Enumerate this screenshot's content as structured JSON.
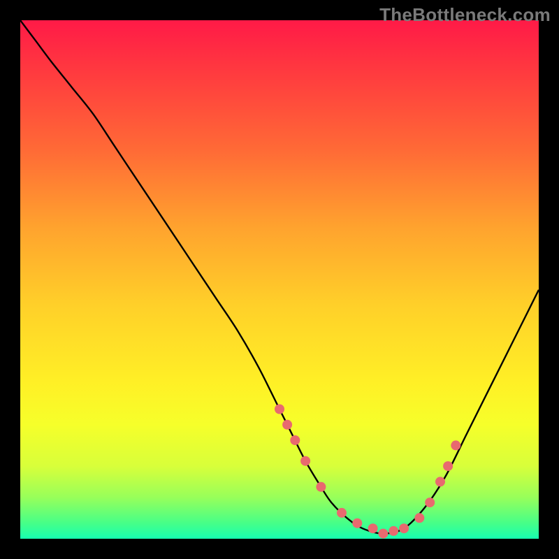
{
  "watermark": "TheBottleneck.com",
  "colors": {
    "gradient_top": "#ff1a47",
    "gradient_bottom": "#17ffb0",
    "curve": "#000000",
    "markers": "#e86a6f",
    "frame": "#000000"
  },
  "chart_data": {
    "type": "line",
    "title": "",
    "xlabel": "",
    "ylabel": "",
    "xlim": [
      0,
      100
    ],
    "ylim": [
      0,
      100
    ],
    "grid": false,
    "series": [
      {
        "name": "bottleneck-curve",
        "x": [
          0,
          3,
          6,
          10,
          14,
          18,
          22,
          26,
          30,
          34,
          38,
          42,
          46,
          50,
          52,
          55,
          58,
          60,
          63,
          66,
          70,
          74,
          78,
          82,
          86,
          90,
          94,
          98,
          100
        ],
        "y": [
          100,
          96,
          92,
          87,
          82,
          76,
          70,
          64,
          58,
          52,
          46,
          40,
          33,
          25,
          21,
          15,
          10,
          7,
          4,
          2,
          1,
          2,
          6,
          12,
          20,
          28,
          36,
          44,
          48
        ]
      }
    ],
    "markers": {
      "name": "highlight-points",
      "x": [
        50,
        51.5,
        53,
        55,
        58,
        62,
        65,
        68,
        70,
        72,
        74,
        77,
        79,
        81,
        82.5,
        84
      ],
      "y": [
        25,
        22,
        19,
        15,
        10,
        5,
        3,
        2,
        1,
        1.5,
        2,
        4,
        7,
        11,
        14,
        18
      ]
    }
  }
}
